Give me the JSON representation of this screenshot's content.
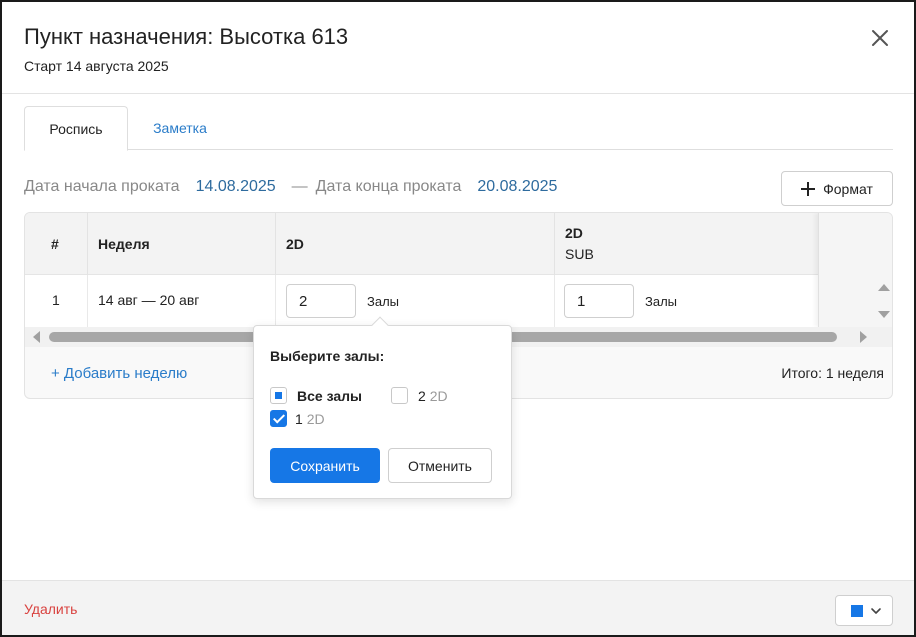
{
  "header": {
    "title": "Пункт назначения: Высотка 613",
    "subtitle": "Старт 14 августа 2025"
  },
  "tabs": [
    {
      "label": "Роспись",
      "active": true
    },
    {
      "label": "Заметка",
      "active": false
    }
  ],
  "dates": {
    "start_label": "Дата начала проката",
    "start_value": "14.08.2025",
    "separator": "—",
    "end_label": "Дата конца проката",
    "end_value": "20.08.2025"
  },
  "format_button": {
    "label": "Формат",
    "icon": "plus-icon"
  },
  "table": {
    "columns": [
      {
        "label": "#"
      },
      {
        "label": "Неделя"
      },
      {
        "label": "2D"
      },
      {
        "label": "2D",
        "sublabel": "SUB"
      }
    ],
    "rows": [
      {
        "index": "1",
        "week": "14 авг — 20 авг",
        "cells": [
          {
            "value": "2",
            "halls_label": "Залы"
          },
          {
            "value": "1",
            "halls_label": "Залы"
          }
        ]
      }
    ],
    "add_week_label": "+ Добавить неделю",
    "total_label": "Итого: 1 неделя"
  },
  "popover": {
    "title": "Выберите залы:",
    "options": [
      {
        "label": "Все залы",
        "state": "indeterminate"
      },
      {
        "label": "2",
        "suffix": "2D",
        "state": "unchecked"
      },
      {
        "label": "1",
        "suffix": "2D",
        "state": "checked"
      }
    ],
    "save_label": "Сохранить",
    "cancel_label": "Отменить"
  },
  "footer": {
    "delete_label": "Удалить",
    "color_value": "#1677e6"
  },
  "colors": {
    "accent": "#1677e6",
    "link": "#2a7cc9",
    "danger": "#d9423f"
  }
}
